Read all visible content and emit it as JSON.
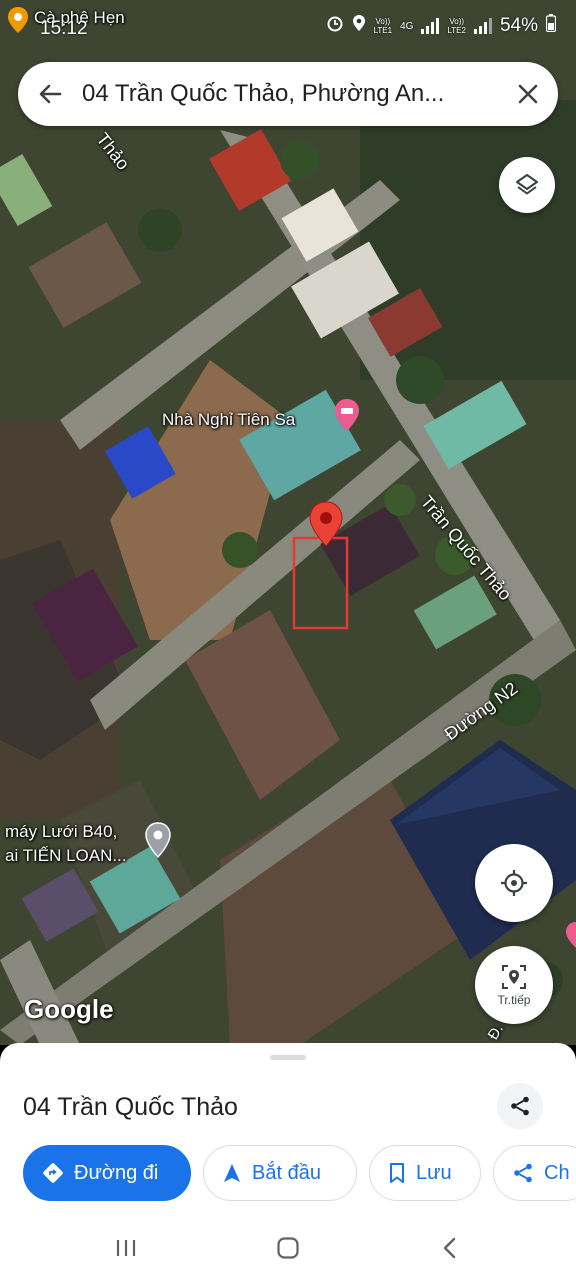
{
  "status_bar": {
    "time": "15:12",
    "carrier1_top": "Vo))",
    "carrier1_bottom": "LTE1",
    "network": "4G",
    "carrier2_top": "Vo))",
    "carrier2_bottom": "LTE2",
    "battery": "54%"
  },
  "search": {
    "query": "04 Trần Quốc Thảo, Phường An..."
  },
  "map": {
    "labels": {
      "cafe": "Cà phê Hẹn",
      "street_top": "Thảo",
      "guesthouse": "Nhà Nghỉ Tiên Sa",
      "street_tran_quoc_thao": "Trần Quốc Thảo",
      "street_n2": "Đường N2",
      "shop_line1": "máy Lưới B40,",
      "shop_line2": "ai TIẾN LOAN...",
      "road_bottom": "Đ. N",
      "google": "Google"
    }
  },
  "buttons": {
    "navigate_label": "Tr.tiếp"
  },
  "place": {
    "title": "04 Trần Quốc Thảo"
  },
  "actions": {
    "directions": "Đường đi",
    "start": "Bắt đầu",
    "save": "Lưu",
    "share": "Ch"
  },
  "colors": {
    "accent": "#1a73e8",
    "pin": "#ea4335",
    "highlight_box": "#e53935"
  }
}
